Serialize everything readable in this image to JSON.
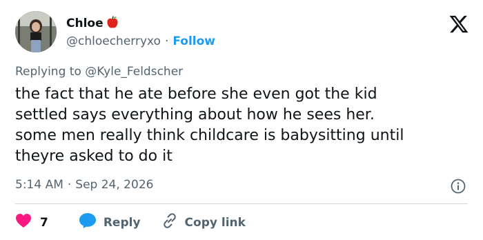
{
  "author": {
    "display_name": "Chloe",
    "name_emoji": "apple-icon",
    "handle": "@chloecherryxo",
    "separator": "·",
    "follow_label": "Follow"
  },
  "reply_context": {
    "prefix": "Replying to ",
    "mention": "@Kyle_Feldscher"
  },
  "tweet": {
    "text": "the fact that he ate before she even got the kid\nsettled says everything about how he sees her.\nsome men really think childcare is babysitting until\ntheyre asked to do it"
  },
  "meta": {
    "time": "5:14 AM",
    "separator": "·",
    "date": "Sep 24, 2026"
  },
  "actions": {
    "likes_count": "7",
    "reply_label": "Reply",
    "copy_label": "Copy link"
  },
  "colors": {
    "text": "#0f1419",
    "secondary": "#536471",
    "accent": "#1d9bf0",
    "like": "#f91880",
    "divider": "#cfd9de"
  },
  "icons": [
    "x-logo-icon",
    "apple-icon",
    "info-icon",
    "heart-icon",
    "reply-bubble-icon",
    "link-icon"
  ]
}
